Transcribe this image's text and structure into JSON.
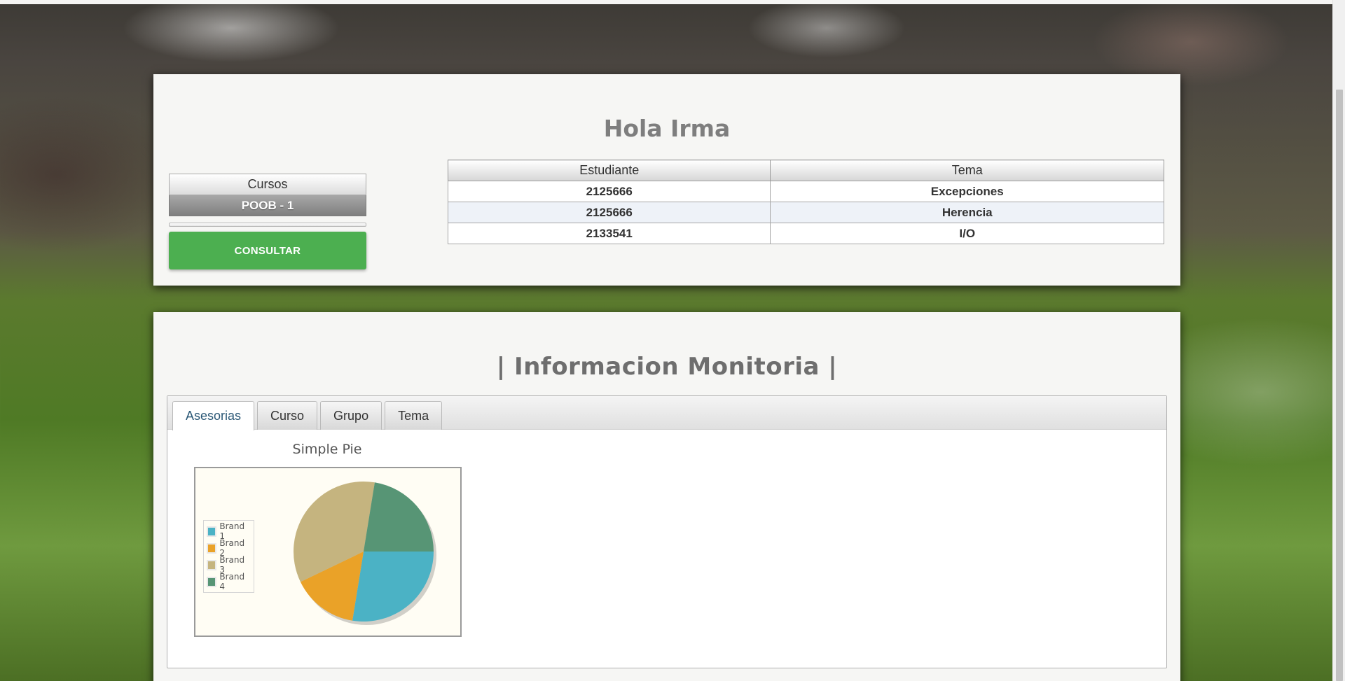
{
  "greeting": "Hola Irma",
  "courses": {
    "header": "Cursos",
    "items": [
      "POOB - 1"
    ],
    "consult_label": "CONSULTAR"
  },
  "table": {
    "columns": [
      "Estudiante",
      "Tema"
    ],
    "rows": [
      [
        "2125666",
        "Excepciones"
      ],
      [
        "2125666",
        "Herencia"
      ],
      [
        "2133541",
        "I/O"
      ]
    ]
  },
  "monitoring": {
    "title": "| Informacion Monitoria |",
    "tabs": [
      {
        "label": "Asesorias",
        "active": true
      },
      {
        "label": "Curso",
        "active": false
      },
      {
        "label": "Grupo",
        "active": false
      },
      {
        "label": "Tema",
        "active": false
      }
    ]
  },
  "chart_data": {
    "type": "pie",
    "title": "Simple Pie",
    "legend_position": "left",
    "slices": [
      {
        "label": "Brand 1",
        "value": 27,
        "color": "#4bb2c5"
      },
      {
        "label": "Brand 2",
        "value": 15,
        "color": "#eaa228"
      },
      {
        "label": "Brand 3",
        "value": 34,
        "color": "#c5b47f"
      },
      {
        "label": "Brand 4",
        "value": 22,
        "color": "#579575"
      }
    ]
  }
}
